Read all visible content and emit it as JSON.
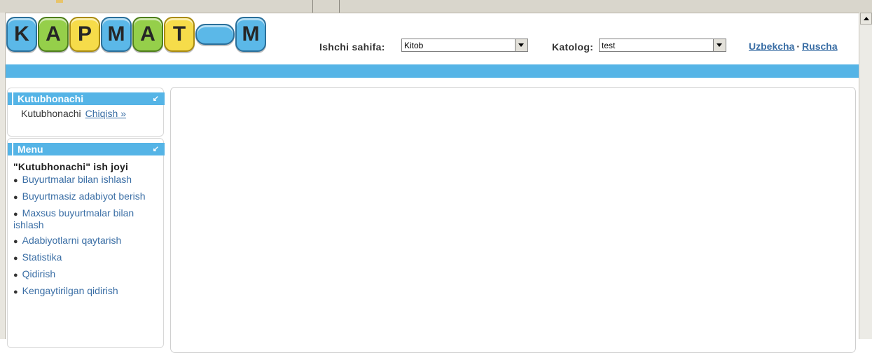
{
  "header": {
    "logo_letters": [
      "K",
      "A",
      "P",
      "M",
      "A",
      "T",
      "",
      "M"
    ],
    "workspace_label": "Ishchi sahifa:",
    "workspace_value": "Kitob",
    "catalog_label": "Katolog:",
    "catalog_value": "test",
    "lang_uz": "Uzbekcha",
    "lang_separator": "·",
    "lang_ru": "Ruscha"
  },
  "user_box": {
    "title": "Kutubhonachi",
    "collapse_icon": "arrow-collapse-icon",
    "user_name": "Kutubhonachi",
    "logout_label": "Chiqish »"
  },
  "menu_box": {
    "title": "Menu",
    "collapse_icon": "arrow-collapse-icon",
    "workspace_title": "\"Kutubhonachi\" ish joyi",
    "items": [
      "Buyurtmalar bilan ishlash",
      "Buyurtmasiz adabiyot berish",
      "Maxsus buyurtmalar bilan ishlash",
      "Adabiyotlarni qaytarish",
      "Statistika",
      "Qidirish",
      "Kengaytirilgan qidirish"
    ]
  },
  "colors": {
    "accent": "#55b4e6",
    "link": "#3a6ea5"
  }
}
